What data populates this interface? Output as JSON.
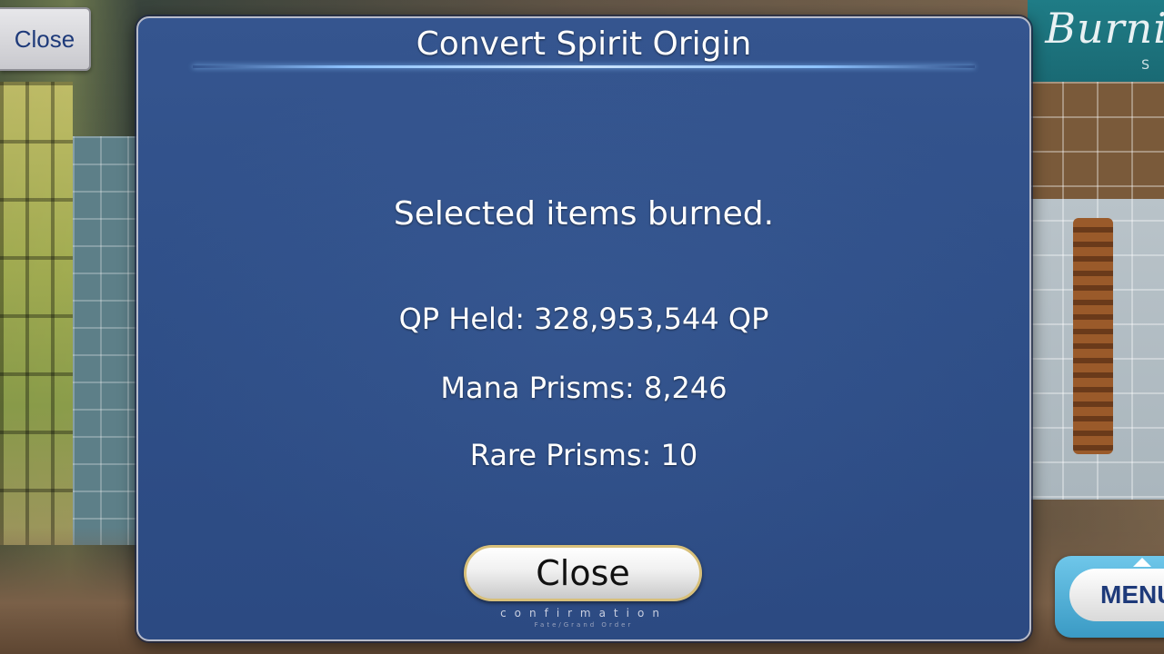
{
  "background": {
    "banner_text": "Burni",
    "banner_sub": "S"
  },
  "top_close_label": "Close",
  "menu_label": "MENU",
  "dialog": {
    "title": "Convert Spirit Origin",
    "message": "Selected items burned.",
    "qp_held": "QP Held: 328,953,544 QP",
    "mana_prisms": "Mana Prisms: 8,246",
    "rare_prisms": "Rare Prisms: 10",
    "close_label": "Close",
    "close_sub": "confirmation",
    "close_sub2": "Fate/Grand Order"
  },
  "colors": {
    "dialog_bg": "#2f4f88",
    "accent_line": "#8ec3ff",
    "button_text": "#1e3a7a"
  }
}
